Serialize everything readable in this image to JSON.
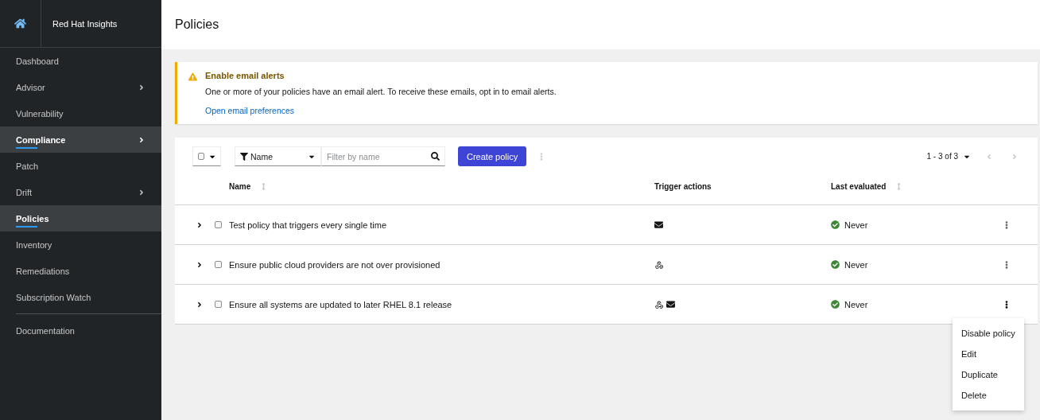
{
  "sidebar": {
    "title": "Red Hat Insights",
    "items": [
      {
        "label": "Dashboard",
        "selected": false,
        "expandable": false
      },
      {
        "label": "Advisor",
        "selected": false,
        "expandable": true
      },
      {
        "label": "Vulnerability",
        "selected": false,
        "expandable": false
      },
      {
        "label": "Compliance",
        "selected": true,
        "expandable": true
      },
      {
        "label": "Patch",
        "selected": false,
        "expandable": false
      },
      {
        "label": "Drift",
        "selected": false,
        "expandable": true
      },
      {
        "label": "Policies",
        "selected": true,
        "expandable": false
      },
      {
        "label": "Inventory",
        "selected": false,
        "expandable": false
      },
      {
        "label": "Remediations",
        "selected": false,
        "expandable": false
      },
      {
        "label": "Subscription Watch",
        "selected": false,
        "expandable": false
      }
    ],
    "footer_items": [
      {
        "label": "Documentation"
      }
    ]
  },
  "page_title": "Policies",
  "alert": {
    "title": "Enable email alerts",
    "message": "One or more of your policies have an email alert. To receive these emails, opt in to email alerts.",
    "link": "Open email preferences"
  },
  "toolbar": {
    "filter_attribute": "Name",
    "search": {
      "placeholder": "Filter by name"
    },
    "create_button": "Create policy",
    "pagination": "1 - 3 of 3"
  },
  "table": {
    "columns": [
      {
        "label": "Name",
        "sortable": true
      },
      {
        "label": "Trigger actions",
        "sortable": false
      },
      {
        "label": "Last evaluated",
        "sortable": true
      }
    ],
    "rows": [
      {
        "name": "Test policy that triggers every single time",
        "checked": false,
        "expanded": false,
        "actions": [
          {
            "kind": "email"
          }
        ],
        "last_evaluated": "Never",
        "menu_open": false
      },
      {
        "name": "Ensure public cloud providers are not over provisioned",
        "checked": false,
        "expanded": false,
        "actions": [
          {
            "kind": "webhook"
          }
        ],
        "last_evaluated": "Never",
        "menu_open": false
      },
      {
        "name": "Ensure all systems are updated to later RHEL 8.1 release",
        "checked": false,
        "expanded": false,
        "actions": [
          {
            "kind": "webhook"
          },
          {
            "kind": "email"
          }
        ],
        "last_evaluated": "Never",
        "menu_open": true
      }
    ]
  },
  "row_menu": {
    "items": [
      "Disable policy",
      "Edit",
      "Duplicate",
      "Delete"
    ]
  }
}
